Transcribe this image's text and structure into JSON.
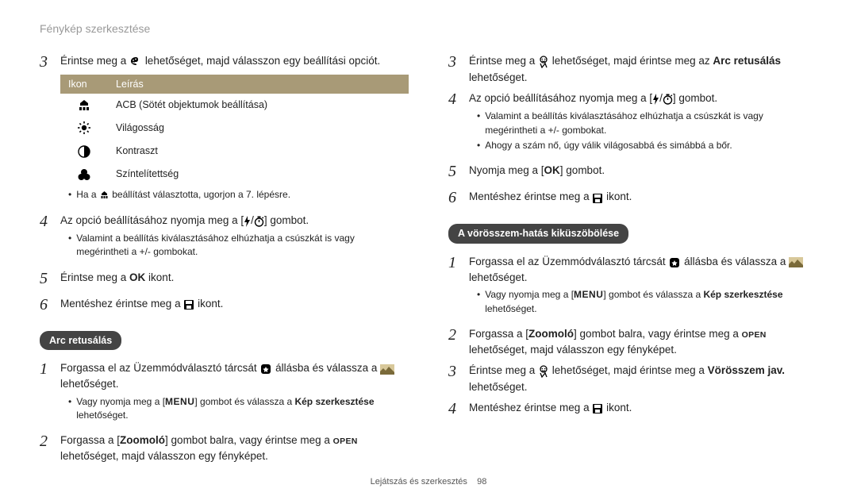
{
  "header": {
    "title": "Fénykép szerkesztése"
  },
  "footer": {
    "section": "Lejátszás és szerkesztés",
    "page": "98"
  },
  "left": {
    "step3": {
      "pre": "Érintse meg a ",
      "post": " lehetőséget, majd válasszon egy beállítási opciót."
    },
    "table": {
      "col_icon": "Ikon",
      "col_desc": "Leírás",
      "rows": [
        {
          "icon": "acb",
          "desc": "ACB (Sötét objektumok beállítása)"
        },
        {
          "icon": "brightness",
          "desc": "Világosság"
        },
        {
          "icon": "contrast",
          "desc": "Kontraszt"
        },
        {
          "icon": "saturation",
          "desc": "Színtelítettség"
        }
      ]
    },
    "step3_note": {
      "pre": "Ha a ",
      "post": " beállítást választotta, ugorjon a 7. lépésre."
    },
    "step4": {
      "pre": "Az opció beállításához nyomja meg a [",
      "post": "] gombot."
    },
    "step4_note": "Valamint a beállítás kiválasztásához elhúzhatja a csúszkát is vagy megérintheti a +/- gombokat.",
    "step5": {
      "pre": "Érintse meg a ",
      "ok": "OK",
      "post": " ikont."
    },
    "step6": {
      "pre": "Mentéshez érintse meg a ",
      "post": " ikont."
    },
    "badge_face": "Arc retusálás",
    "face1": {
      "pre": "Forgassa el az Üzemmódválasztó tárcsát ",
      "mid": " állásba és válassza a ",
      "post": " lehetőséget."
    },
    "face1_note": {
      "pre": "Vagy nyomja meg a [",
      "menu": "MENU",
      "mid": "] gombot és válassza a ",
      "bold": "Kép szerkesztése",
      "post": " lehetőséget."
    },
    "face2": {
      "pre1": "Forgassa a [",
      "zoom": "Zoomoló",
      "pre2": "] gombot balra, vagy érintse meg a ",
      "open": "OPEN",
      "post": " lehetőséget, majd válasszon egy fényképet."
    }
  },
  "right": {
    "step3": {
      "pre": "Érintse meg a ",
      "mid": " lehetőséget, majd érintse meg az ",
      "bold": "Arc retusálás",
      "post": " lehetőséget."
    },
    "step4": {
      "pre": "Az opció beállításához nyomja meg a [",
      "post": "] gombot."
    },
    "step4_note1": "Valamint a beállítás kiválasztásához elhúzhatja a csúszkát is vagy megérintheti a +/- gombokat.",
    "step4_note2": "Ahogy a szám nő, úgy válik világosabbá és simábbá a bőr.",
    "step5": {
      "pre": "Nyomja meg a [",
      "ok": "OK",
      "post": "] gombot."
    },
    "step6": {
      "pre": "Mentéshez érintse meg a ",
      "post": " ikont."
    },
    "badge_redeye": "A vörösszem-hatás kiküszöbölése",
    "red1": {
      "pre": "Forgassa el az Üzemmódválasztó tárcsát ",
      "mid": " állásba és válassza a ",
      "post": " lehetőséget."
    },
    "red1_note": {
      "pre": "Vagy nyomja meg a [",
      "menu": "MENU",
      "mid": "] gombot és válassza a ",
      "bold": "Kép szerkesztése",
      "post": " lehetőséget."
    },
    "red2": {
      "pre1": "Forgassa a [",
      "zoom": "Zoomoló",
      "pre2": "] gombot balra, vagy érintse meg a ",
      "open": "OPEN",
      "post": " lehetőséget, majd válasszon egy fényképet."
    },
    "red3": {
      "pre": "Érintse meg a ",
      "mid": " lehetőséget, majd érintse meg a ",
      "bold": "Vörösszem jav.",
      "post": " lehetőséget."
    },
    "red4": {
      "pre": "Mentéshez érintse meg a ",
      "post": " ikont."
    }
  }
}
